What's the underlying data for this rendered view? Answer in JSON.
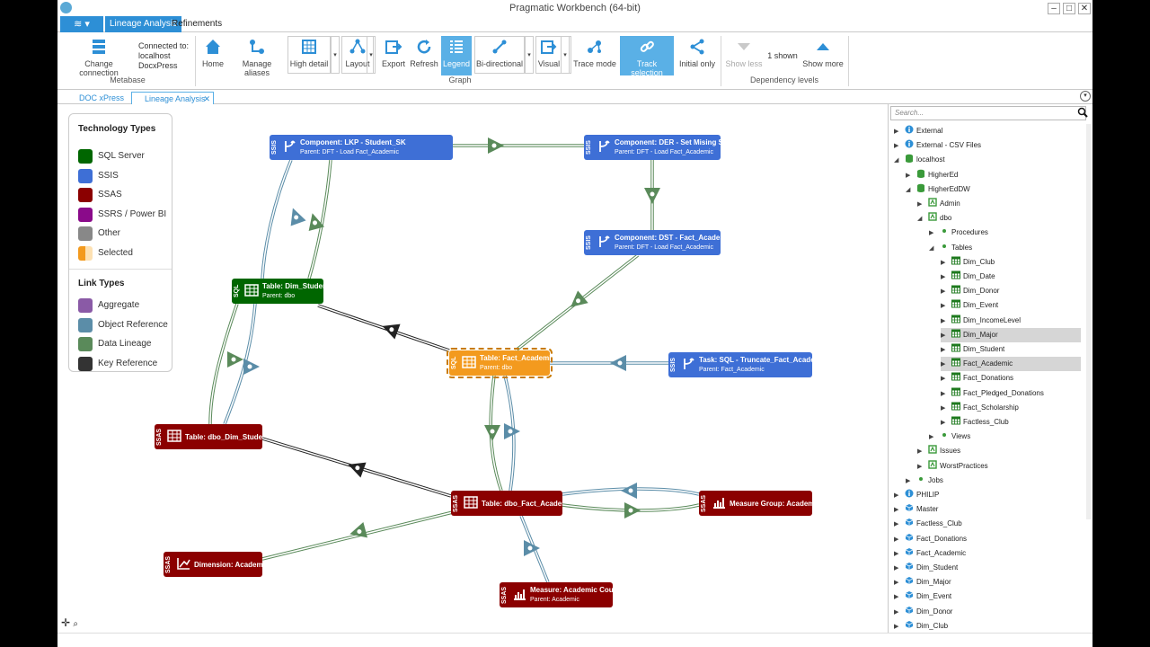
{
  "window": {
    "title": "Pragmatic Workbench (64-bit)"
  },
  "ribbon_tabs": [
    {
      "label": "Lineage Analysis"
    },
    {
      "label": "Refinements"
    }
  ],
  "metabase": {
    "change_connection": "Change connection",
    "connected_label": "Connected to:",
    "server": "localhost",
    "database": "DocxPress",
    "group": "Metabase"
  },
  "graph": {
    "home": "Home",
    "manage_aliases": "Manage aliases",
    "high_detail": "High detail",
    "layout": "Layout",
    "export": "Export",
    "refresh": "Refresh",
    "legend": "Legend",
    "bidirectional": "Bi-directional",
    "visual": "Visual",
    "trace_mode": "Trace mode",
    "track_selection": "Track selection",
    "initial_only": "Initial only",
    "group": "Graph"
  },
  "dependency": {
    "show_less": "Show less",
    "shown": "1 shown",
    "show_more": "Show more",
    "group": "Dependency levels"
  },
  "doc_tabs": [
    {
      "label": "DOC xPress"
    },
    {
      "label": "Lineage Analysis"
    }
  ],
  "legend": {
    "tech_title": "Technology Types",
    "tech": [
      {
        "label": "SQL Server",
        "color": "#006600"
      },
      {
        "label": "SSIS",
        "color": "#3e6fd6"
      },
      {
        "label": "SSAS",
        "color": "#8b0000"
      },
      {
        "label": "SSRS / Power BI",
        "color": "#8a0a8a"
      },
      {
        "label": "Other",
        "color": "#888888"
      },
      {
        "label": "Selected",
        "color": "#f39a1e"
      }
    ],
    "link_title": "Link Types",
    "links": [
      {
        "label": "Aggregate",
        "color": "#8a5aa6"
      },
      {
        "label": "Object Reference",
        "color": "#5b8da8"
      },
      {
        "label": "Data Lineage",
        "color": "#5a8a5a"
      },
      {
        "label": "Key Reference",
        "color": "#333333"
      }
    ]
  },
  "nodes": [
    {
      "id": "lkp",
      "tech": "SSIS",
      "title": "Component: LKP - Student_SK",
      "parent": "Parent: DFT - Load Fact_Academic",
      "color": "#3e6fd6",
      "icon": "branch-icon"
    },
    {
      "id": "der",
      "tech": "SSIS",
      "title": "Component: DER - Set Mising SKs",
      "parent": "Parent: DFT - Load Fact_Academic",
      "color": "#3e6fd6",
      "icon": "branch-icon"
    },
    {
      "id": "dst",
      "tech": "SSIS",
      "title": "Component: DST - Fact_Academic",
      "parent": "Parent: DFT - Load Fact_Academic",
      "color": "#3e6fd6",
      "icon": "branch-icon"
    },
    {
      "id": "dimstudent",
      "tech": "SQL",
      "title": "Table: Dim_Student",
      "parent": "Parent: dbo",
      "color": "#006600",
      "icon": "table-icon"
    },
    {
      "id": "factacademic",
      "tech": "SQL",
      "title": "Table: Fact_Academic",
      "parent": "Parent: dbo",
      "color": "#f39a1e",
      "icon": "table-icon"
    },
    {
      "id": "task",
      "tech": "SSIS",
      "title": "Task: SQL - Truncate_Fact_Academic",
      "parent": "Parent: Fact_Academic",
      "color": "#3e6fd6",
      "icon": "branch-icon"
    },
    {
      "id": "ssasdim",
      "tech": "SSAS",
      "title": "Table: dbo_Dim_Student",
      "parent": "",
      "color": "#8b0000",
      "icon": "table-icon"
    },
    {
      "id": "ssasfact",
      "tech": "SSAS",
      "title": "Table: dbo_Fact_Academic",
      "parent": "",
      "color": "#8b0000",
      "icon": "table-icon"
    },
    {
      "id": "measuregroup",
      "tech": "SSAS",
      "title": "Measure Group: Academic",
      "parent": "",
      "color": "#8b0000",
      "icon": "bar-chart-icon"
    },
    {
      "id": "dimension",
      "tech": "SSAS",
      "title": "Dimension: Academic",
      "parent": "",
      "color": "#8b0000",
      "icon": "axis-icon"
    },
    {
      "id": "measure",
      "tech": "SSAS",
      "title": "Measure: Academic Count",
      "parent": "Parent: Academic",
      "color": "#8b0000",
      "icon": "bar-chart-icon"
    }
  ],
  "tree": {
    "search_placeholder": "Search...",
    "items": [
      {
        "label": "External",
        "arrow": "▶",
        "icon": "info"
      },
      {
        "label": "External - CSV Files",
        "arrow": "▶",
        "icon": "info"
      },
      {
        "label": "localhost",
        "arrow": "◢",
        "icon": "db"
      },
      {
        "label": "HigherEd",
        "arrow": "▶",
        "icon": "db"
      },
      {
        "label": "HigherEdDW",
        "arrow": "◢",
        "icon": "db"
      },
      {
        "label": "Admin",
        "arrow": "▶",
        "icon": "schema"
      },
      {
        "label": "dbo",
        "arrow": "◢",
        "icon": "schema"
      },
      {
        "label": "Procedures",
        "arrow": "▶",
        "icon": "dot"
      },
      {
        "label": "Tables",
        "arrow": "◢",
        "icon": "dot"
      },
      {
        "label": "Dim_Club",
        "arrow": "▶",
        "icon": "table"
      },
      {
        "label": "Dim_Date",
        "arrow": "▶",
        "icon": "table"
      },
      {
        "label": "Dim_Donor",
        "arrow": "▶",
        "icon": "table"
      },
      {
        "label": "Dim_Event",
        "arrow": "▶",
        "icon": "table"
      },
      {
        "label": "Dim_IncomeLevel",
        "arrow": "▶",
        "icon": "table"
      },
      {
        "label": "Dim_Major",
        "arrow": "▶",
        "icon": "table",
        "selected": true
      },
      {
        "label": "Dim_Student",
        "arrow": "▶",
        "icon": "table"
      },
      {
        "label": "Fact_Academic",
        "arrow": "▶",
        "icon": "table",
        "selected": true
      },
      {
        "label": "Fact_Donations",
        "arrow": "▶",
        "icon": "table"
      },
      {
        "label": "Fact_Pledged_Donations",
        "arrow": "▶",
        "icon": "table"
      },
      {
        "label": "Fact_Scholarship",
        "arrow": "▶",
        "icon": "table"
      },
      {
        "label": "Factless_Club",
        "arrow": "▶",
        "icon": "table"
      },
      {
        "label": "Views",
        "arrow": "▶",
        "icon": "dot"
      },
      {
        "label": "Issues",
        "arrow": "▶",
        "icon": "schema"
      },
      {
        "label": "WorstPractices",
        "arrow": "▶",
        "icon": "schema"
      },
      {
        "label": "Jobs",
        "arrow": "▶",
        "icon": "dot"
      },
      {
        "label": "PHILIP",
        "arrow": "▶",
        "icon": "info"
      },
      {
        "label": "Master",
        "arrow": "▶",
        "icon": "cube"
      },
      {
        "label": "Factless_Club",
        "arrow": "▶",
        "icon": "cube"
      },
      {
        "label": "Fact_Donations",
        "arrow": "▶",
        "icon": "cube"
      },
      {
        "label": "Fact_Academic",
        "arrow": "▶",
        "icon": "cube"
      },
      {
        "label": "Dim_Student",
        "arrow": "▶",
        "icon": "cube"
      },
      {
        "label": "Dim_Major",
        "arrow": "▶",
        "icon": "cube"
      },
      {
        "label": "Dim_Event",
        "arrow": "▶",
        "icon": "cube"
      },
      {
        "label": "Dim_Donor",
        "arrow": "▶",
        "icon": "cube"
      },
      {
        "label": "Dim_Club",
        "arrow": "▶",
        "icon": "cube"
      }
    ]
  }
}
